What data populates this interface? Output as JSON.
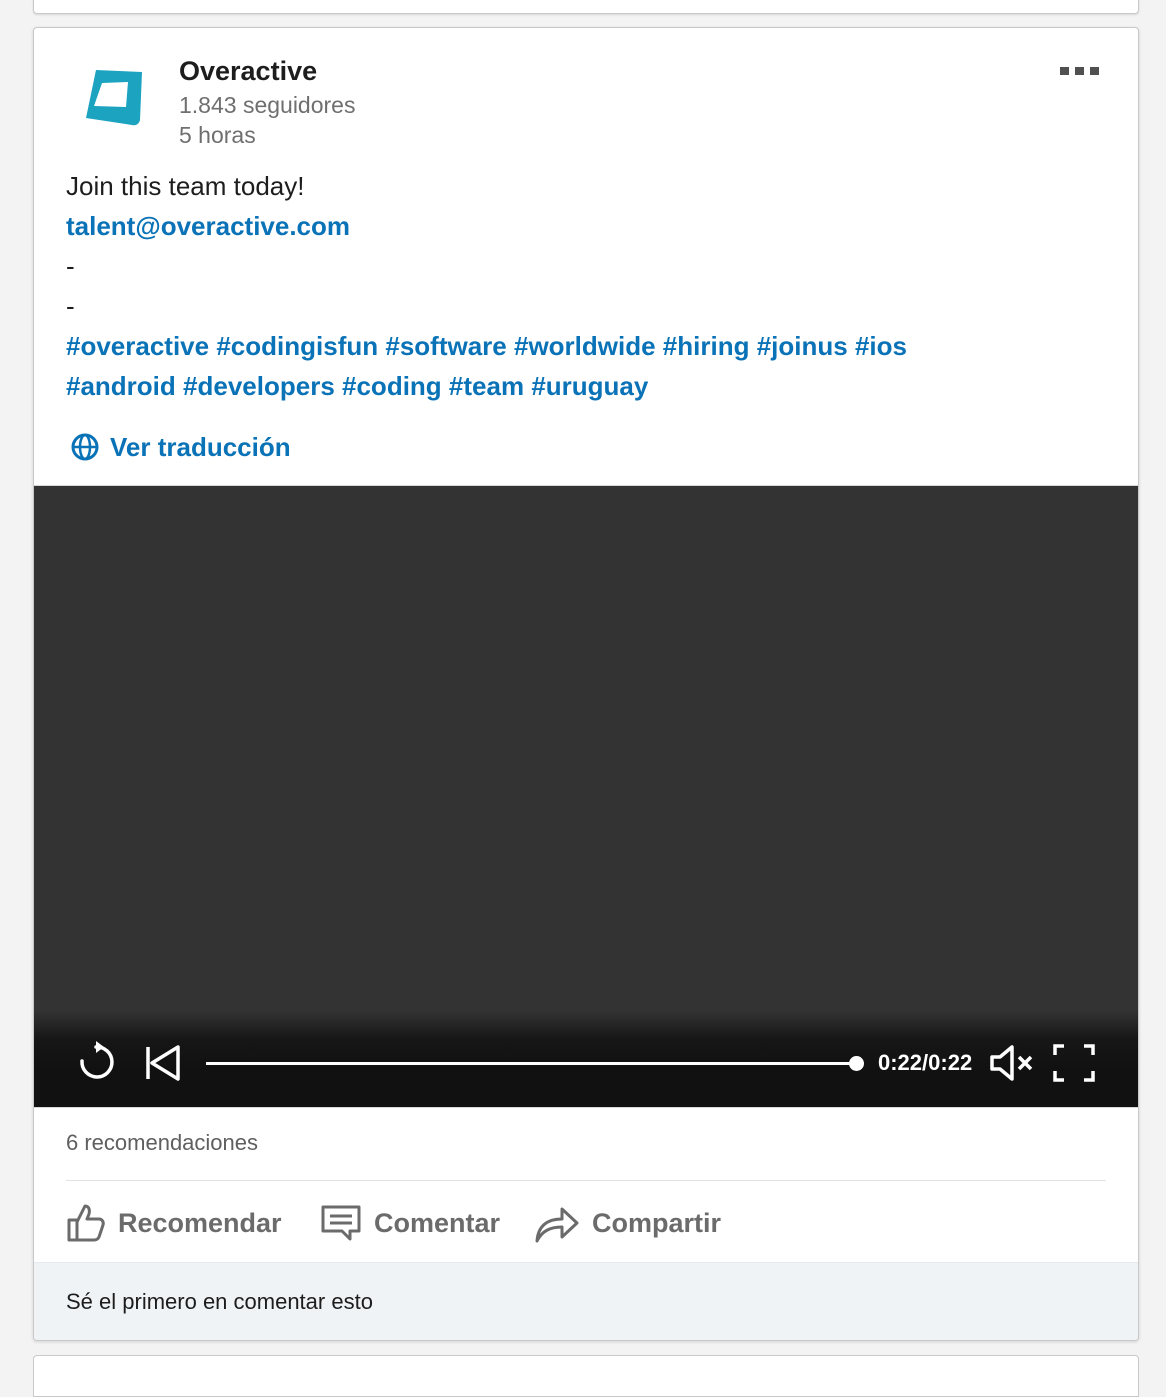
{
  "post": {
    "author": {
      "name": "Overactive",
      "followers": "1.843 seguidores",
      "time": "5 horas",
      "logo_icon": "overactive-logo",
      "logo_color": "#1ba3c0"
    },
    "menu_icon": "more-horizontal-icon",
    "body_lines": [
      "Join this team today!",
      "talent@overactive.com",
      "-",
      "-"
    ],
    "hashtags": [
      "#overactive",
      "#codingisfun",
      "#software",
      "#worldwide",
      "#hiring",
      "#joinus",
      "#ios",
      "#android",
      "#developers",
      "#coding",
      "#team",
      "#uruguay"
    ],
    "translate_label": "Ver traducción",
    "link_color": "#0a72b6"
  },
  "video": {
    "time_label": "0:22/0:22",
    "progress": 1.0,
    "muted": true,
    "background_color": "#333333"
  },
  "social": {
    "reactions_count": "6 recomendaciones",
    "actions": {
      "recommend": "Recomendar",
      "comment": "Comentar",
      "share": "Compartir"
    },
    "comment_prompt": "Sé el primero en comentar esto"
  }
}
